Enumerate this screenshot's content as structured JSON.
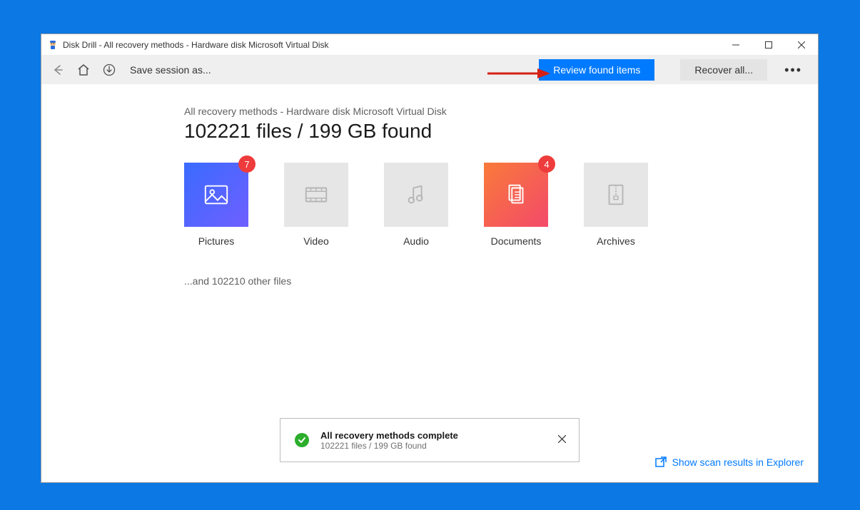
{
  "window": {
    "title": "Disk Drill - All recovery methods - Hardware disk Microsoft Virtual Disk"
  },
  "toolbar": {
    "save_session": "Save session as...",
    "review_btn": "Review found items",
    "recover_btn": "Recover all..."
  },
  "main": {
    "breadcrumb": "All recovery methods - Hardware disk Microsoft Virtual Disk",
    "headline": "102221 files / 199 GB found",
    "other_files": "...and 102210 other files"
  },
  "categories": [
    {
      "label": "Pictures",
      "badge": "7"
    },
    {
      "label": "Video",
      "badge": null
    },
    {
      "label": "Audio",
      "badge": null
    },
    {
      "label": "Documents",
      "badge": "4"
    },
    {
      "label": "Archives",
      "badge": null
    }
  ],
  "notification": {
    "title": "All recovery methods complete",
    "subtitle": "102221 files / 199 GB found"
  },
  "footer": {
    "explorer_link": "Show scan results in Explorer"
  }
}
